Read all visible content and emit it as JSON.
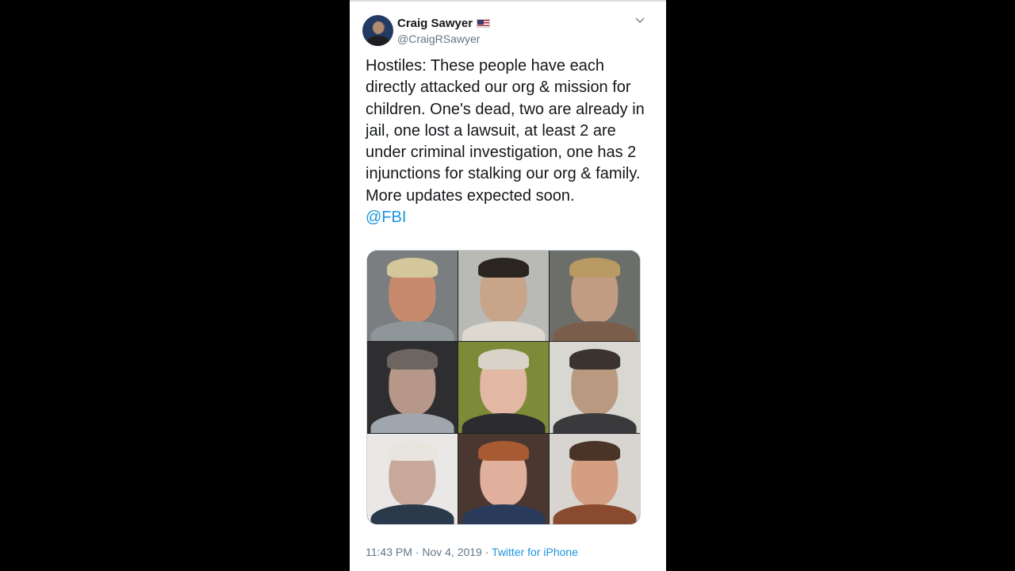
{
  "tweet": {
    "display_name": "Craig Sawyer",
    "flag_icon": "us-flag-icon",
    "handle": "@CraigRSawyer",
    "menu_icon": "chevron-down-icon",
    "body": "Hostiles: These people have each directly attacked our org & mission for children. One's dead, two are already in jail, one lost a lawsuit, at least 2 are under criminal investigation, one has 2 injunctions for stalking our org & family. More updates expected soon.",
    "mention": "@FBI",
    "time": "11:43 PM",
    "separator": " · ",
    "date": "Nov 4, 2019",
    "source": "Twitter for iPhone"
  },
  "colors": {
    "link": "#1b95e0",
    "text": "#14171a",
    "secondary": "#657786"
  }
}
